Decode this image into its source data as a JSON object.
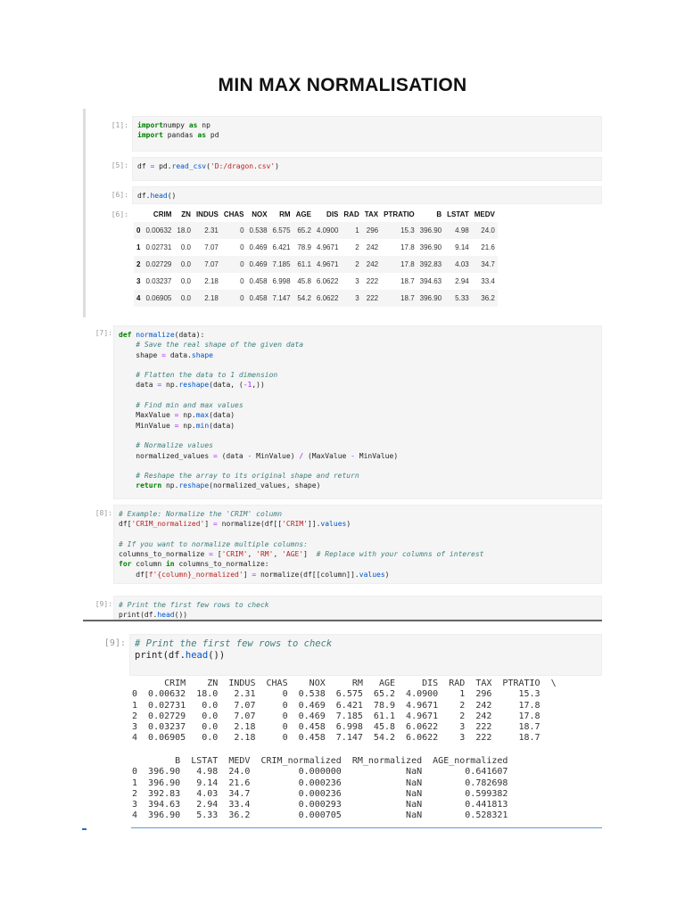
{
  "title": "MIN MAX NORMALISATION",
  "cells": [
    {
      "prompt": "[1]:",
      "lines": [
        [
          [
            "kw",
            "import"
          ],
          [
            "",
            "numpy "
          ],
          [
            "kw",
            "as"
          ],
          [
            "",
            " np"
          ]
        ],
        [
          [
            "kw",
            "import"
          ],
          [
            "",
            " pandas "
          ],
          [
            "kw",
            "as"
          ],
          [
            "",
            " pd"
          ]
        ]
      ]
    },
    {
      "prompt": "[5]:",
      "lines": [
        [
          [
            "",
            "df "
          ],
          [
            "op",
            "="
          ],
          [
            "",
            " pd."
          ],
          [
            "fn",
            "read_csv"
          ],
          [
            "",
            "("
          ],
          [
            "st",
            "'D:/dragon.csv'"
          ],
          [
            "",
            ")"
          ]
        ]
      ]
    },
    {
      "prompt": "[6]:",
      "lines": [
        [
          [
            "",
            "df."
          ],
          [
            "fn",
            "head"
          ],
          [
            "",
            "()"
          ]
        ]
      ]
    },
    {
      "prompt": "[7]:",
      "lines": [
        [
          [
            "kw",
            "def"
          ],
          [
            "",
            " "
          ],
          [
            "fn",
            "normalize"
          ],
          [
            "",
            "(data):"
          ]
        ],
        [
          [
            "",
            "    "
          ],
          [
            "cm",
            "# Save the real shape of the given data"
          ]
        ],
        [
          [
            "",
            "    shape "
          ],
          [
            "op",
            "="
          ],
          [
            "",
            " data."
          ],
          [
            "fn",
            "shape"
          ]
        ],
        [
          [
            "",
            ""
          ]
        ],
        [
          [
            "",
            "    "
          ],
          [
            "cm",
            "# Flatten the data to 1 dimension"
          ]
        ],
        [
          [
            "",
            "    data "
          ],
          [
            "op",
            "="
          ],
          [
            "",
            " np."
          ],
          [
            "fn",
            "reshape"
          ],
          [
            "",
            "(data, ("
          ],
          [
            "op",
            "-1"
          ],
          [
            "",
            ",))"
          ]
        ],
        [
          [
            "",
            ""
          ]
        ],
        [
          [
            "",
            "    "
          ],
          [
            "cm",
            "# Find min and max values"
          ]
        ],
        [
          [
            "",
            "    MaxValue "
          ],
          [
            "op",
            "="
          ],
          [
            "",
            " np."
          ],
          [
            "fn",
            "max"
          ],
          [
            "",
            "(data)"
          ]
        ],
        [
          [
            "",
            "    MinValue "
          ],
          [
            "op",
            "="
          ],
          [
            "",
            " np."
          ],
          [
            "fn",
            "min"
          ],
          [
            "",
            "(data)"
          ]
        ],
        [
          [
            "",
            ""
          ]
        ],
        [
          [
            "",
            "    "
          ],
          [
            "cm",
            "# Normalize values"
          ]
        ],
        [
          [
            "",
            "    normalized_values "
          ],
          [
            "op",
            "="
          ],
          [
            "",
            " (data "
          ],
          [
            "op",
            "-"
          ],
          [
            "",
            " MinValue) "
          ],
          [
            "op",
            "/"
          ],
          [
            "",
            " (MaxValue "
          ],
          [
            "op",
            "-"
          ],
          [
            "",
            " MinValue)"
          ]
        ],
        [
          [
            "",
            ""
          ]
        ],
        [
          [
            "",
            "    "
          ],
          [
            "cm",
            "# Reshape the array to its original shape and return"
          ]
        ],
        [
          [
            "",
            "    "
          ],
          [
            "kw",
            "return"
          ],
          [
            "",
            " np."
          ],
          [
            "fn",
            "reshape"
          ],
          [
            "",
            "(normalized_values, shape)"
          ]
        ]
      ]
    },
    {
      "prompt": "[8]:",
      "lines": [
        [
          [
            "cm",
            "# Example: Normalize the 'CRIM' column"
          ]
        ],
        [
          [
            "",
            "df["
          ],
          [
            "st",
            "'CRIM_normalized'"
          ],
          [
            "",
            "] "
          ],
          [
            "op",
            "="
          ],
          [
            "",
            " normalize(df[["
          ],
          [
            "st",
            "'CRIM'"
          ],
          [
            "",
            "]]."
          ],
          [
            "fn",
            "values"
          ],
          [
            "",
            ")"
          ]
        ],
        [
          [
            "",
            ""
          ]
        ],
        [
          [
            "cm",
            "# If you want to normalize multiple columns:"
          ]
        ],
        [
          [
            "",
            "columns_to_normalize "
          ],
          [
            "op",
            "="
          ],
          [
            "",
            " ["
          ],
          [
            "st",
            "'CRIM'"
          ],
          [
            "",
            ", "
          ],
          [
            "st",
            "'RM'"
          ],
          [
            "",
            ", "
          ],
          [
            "st",
            "'AGE'"
          ],
          [
            "",
            "]  "
          ],
          [
            "cm",
            "# Replace with your columns of interest"
          ]
        ],
        [
          [
            "kw",
            "for"
          ],
          [
            "",
            " column "
          ],
          [
            "kw",
            "in"
          ],
          [
            "",
            " columns_to_normalize:"
          ]
        ],
        [
          [
            "",
            "    df["
          ],
          [
            "st",
            "f'{column}_normalized'"
          ],
          [
            "",
            "] "
          ],
          [
            "op",
            "="
          ],
          [
            "",
            " normalize(df[[column]]."
          ],
          [
            "fn",
            "values"
          ],
          [
            "",
            ")"
          ]
        ]
      ]
    },
    {
      "prompt": "[9]:",
      "lines": [
        [
          [
            "cm",
            "# Print the first few rows to check"
          ]
        ],
        [
          [
            "",
            "print(df."
          ],
          [
            "fn",
            "head"
          ],
          [
            "",
            "())"
          ]
        ]
      ]
    },
    {
      "prompt": "[9]:",
      "lines": [
        [
          [
            "cm",
            "# Print the first few rows to check"
          ]
        ],
        [
          [
            "",
            "print(df."
          ],
          [
            "fn",
            "head"
          ],
          [
            "",
            "())"
          ]
        ]
      ]
    }
  ],
  "table": {
    "prompt": "[6]:",
    "columns": [
      "",
      "CRIM",
      "ZN",
      "INDUS",
      "CHAS",
      "NOX",
      "RM",
      "AGE",
      "DIS",
      "RAD",
      "TAX",
      "PTRATIO",
      "B",
      "LSTAT",
      "MEDV"
    ],
    "rows": [
      [
        "0",
        "0.00632",
        "18.0",
        "2.31",
        "0",
        "0.538",
        "6.575",
        "65.2",
        "4.0900",
        "1",
        "296",
        "15.3",
        "396.90",
        "4.98",
        "24.0"
      ],
      [
        "1",
        "0.02731",
        "0.0",
        "7.07",
        "0",
        "0.469",
        "6.421",
        "78.9",
        "4.9671",
        "2",
        "242",
        "17.8",
        "396.90",
        "9.14",
        "21.6"
      ],
      [
        "2",
        "0.02729",
        "0.0",
        "7.07",
        "0",
        "0.469",
        "7.185",
        "61.1",
        "4.9671",
        "2",
        "242",
        "17.8",
        "392.83",
        "4.03",
        "34.7"
      ],
      [
        "3",
        "0.03237",
        "0.0",
        "2.18",
        "0",
        "0.458",
        "6.998",
        "45.8",
        "6.0622",
        "3",
        "222",
        "18.7",
        "394.63",
        "2.94",
        "33.4"
      ],
      [
        "4",
        "0.06905",
        "0.0",
        "2.18",
        "0",
        "0.458",
        "7.147",
        "54.2",
        "6.0622",
        "3",
        "222",
        "18.7",
        "396.90",
        "5.33",
        "36.2"
      ]
    ]
  },
  "printed_output": {
    "block1": [
      "      CRIM    ZN  INDUS  CHAS    NOX     RM   AGE     DIS  RAD  TAX  PTRATIO  \\",
      "0  0.00632  18.0   2.31     0  0.538  6.575  65.2  4.0900    1  296     15.3",
      "1  0.02731   0.0   7.07     0  0.469  6.421  78.9  4.9671    2  242     17.8",
      "2  0.02729   0.0   7.07     0  0.469  7.185  61.1  4.9671    2  242     17.8",
      "3  0.03237   0.0   2.18     0  0.458  6.998  45.8  6.0622    3  222     18.7",
      "4  0.06905   0.0   2.18     0  0.458  7.147  54.2  6.0622    3  222     18.7"
    ],
    "block2": [
      "        B  LSTAT  MEDV  CRIM_normalized  RM_normalized  AGE_normalized",
      "0  396.90   4.98  24.0         0.000000            NaN        0.641607",
      "1  396.90   9.14  21.6         0.000236            NaN        0.782698",
      "2  392.83   4.03  34.7         0.000236            NaN        0.599382",
      "3  394.63   2.94  33.4         0.000293            NaN        0.441813",
      "4  396.90   5.33  36.2         0.000705            NaN        0.528321"
    ]
  }
}
